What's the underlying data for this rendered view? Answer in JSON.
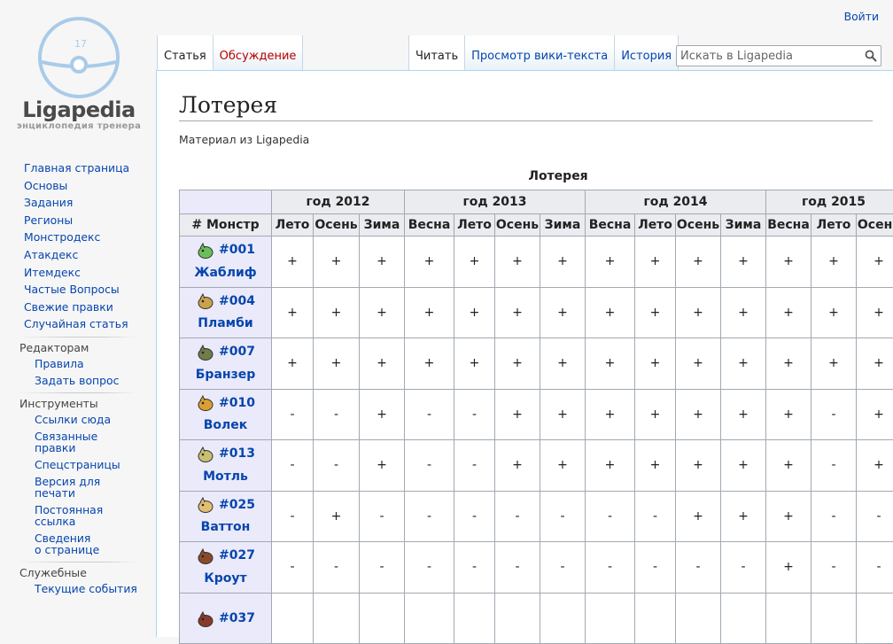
{
  "logo": {
    "title": "Ligapedia",
    "subtitle": "энциклопедия тренера",
    "badge": "17"
  },
  "nav": {
    "main": [
      "Главная страница",
      "Основы",
      "Задания",
      "Регионы",
      "Монстродекс",
      "Атакдекс",
      "Итемдекс",
      "Частые Вопросы",
      "Свежие правки",
      "Случайная статья"
    ],
    "portals": [
      {
        "heading": "Редакторам",
        "items": [
          [
            "Правила"
          ],
          [
            "Задать вопрос"
          ]
        ]
      },
      {
        "heading": "Инструменты",
        "items": [
          [
            "Ссылки сюда"
          ],
          [
            "Связанные правки"
          ],
          [
            "Спецстраницы"
          ],
          [
            "Версия для",
            "печати"
          ],
          [
            "Постоянная",
            "ссылка"
          ],
          [
            "Сведения",
            "о странице"
          ]
        ]
      },
      {
        "heading": "Служебные",
        "items": [
          [
            "Текущие события"
          ]
        ]
      }
    ]
  },
  "header": {
    "login": "Войти",
    "tabs_left": [
      "Статья",
      "Обсуждение"
    ],
    "tabs_right": [
      "Читать",
      "Просмотр вики-текста",
      "История"
    ],
    "search_placeholder": "Искать в Ligapedia"
  },
  "page": {
    "title": "Лотерея",
    "sitesub": "Материал из Ligapedia"
  },
  "table": {
    "caption": "Лотерея",
    "years": [
      {
        "label": "год 2012",
        "span": 3
      },
      {
        "label": "год 2013",
        "span": 4
      },
      {
        "label": "год 2014",
        "span": 4
      },
      {
        "label": "год 2015",
        "span": 3
      }
    ],
    "monster_header": "# Монстр",
    "seasons": [
      "Лето",
      "Осень",
      "Зима",
      "Весна",
      "Лето",
      "Осень",
      "Зима",
      "Весна",
      "Лето",
      "Осень",
      "Зима",
      "Весна",
      "Лето",
      "Осень"
    ],
    "rows": [
      {
        "num": "#001",
        "name": "Жаблиф",
        "sprite_color": "#6bbf59",
        "cells": [
          "+",
          "+",
          "+",
          "+",
          "+",
          "+",
          "+",
          "+",
          "+",
          "+",
          "+",
          "+",
          "+",
          "+"
        ]
      },
      {
        "num": "#004",
        "name": "Пламби",
        "sprite_color": "#c9a24a",
        "cells": [
          "+",
          "+",
          "+",
          "+",
          "+",
          "+",
          "+",
          "+",
          "+",
          "+",
          "+",
          "+",
          "+",
          "+"
        ]
      },
      {
        "num": "#007",
        "name": "Бранзер",
        "sprite_color": "#6f7d4a",
        "cells": [
          "+",
          "+",
          "+",
          "+",
          "+",
          "+",
          "+",
          "+",
          "+",
          "+",
          "+",
          "+",
          "+",
          "+"
        ]
      },
      {
        "num": "#010",
        "name": "Волек",
        "sprite_color": "#d9a030",
        "cells": [
          "-",
          "-",
          "+",
          "-",
          "-",
          "+",
          "+",
          "+",
          "+",
          "+",
          "+",
          "+",
          "-",
          "+"
        ]
      },
      {
        "num": "#013",
        "name": "Мотль",
        "sprite_color": "#c8c070",
        "cells": [
          "-",
          "-",
          "+",
          "-",
          "-",
          "+",
          "+",
          "+",
          "+",
          "+",
          "+",
          "+",
          "-",
          "+"
        ]
      },
      {
        "num": "#025",
        "name": "Ваттон",
        "sprite_color": "#e0c070",
        "cells": [
          "-",
          "+",
          "-",
          "-",
          "-",
          "-",
          "-",
          "-",
          "-",
          "+",
          "+",
          "+",
          "-",
          "-"
        ]
      },
      {
        "num": "#027",
        "name": "Кроут",
        "sprite_color": "#8a4a2a",
        "cells": [
          "-",
          "-",
          "-",
          "-",
          "-",
          "-",
          "-",
          "-",
          "-",
          "-",
          "-",
          "+",
          "-",
          "-"
        ]
      },
      {
        "num": "#037",
        "name": "",
        "sprite_color": "#8a3a2a",
        "cells": [
          "",
          "",
          "",
          "",
          "",
          "",
          "",
          "",
          "",
          "",
          "",
          "",
          "",
          ""
        ]
      }
    ]
  }
}
